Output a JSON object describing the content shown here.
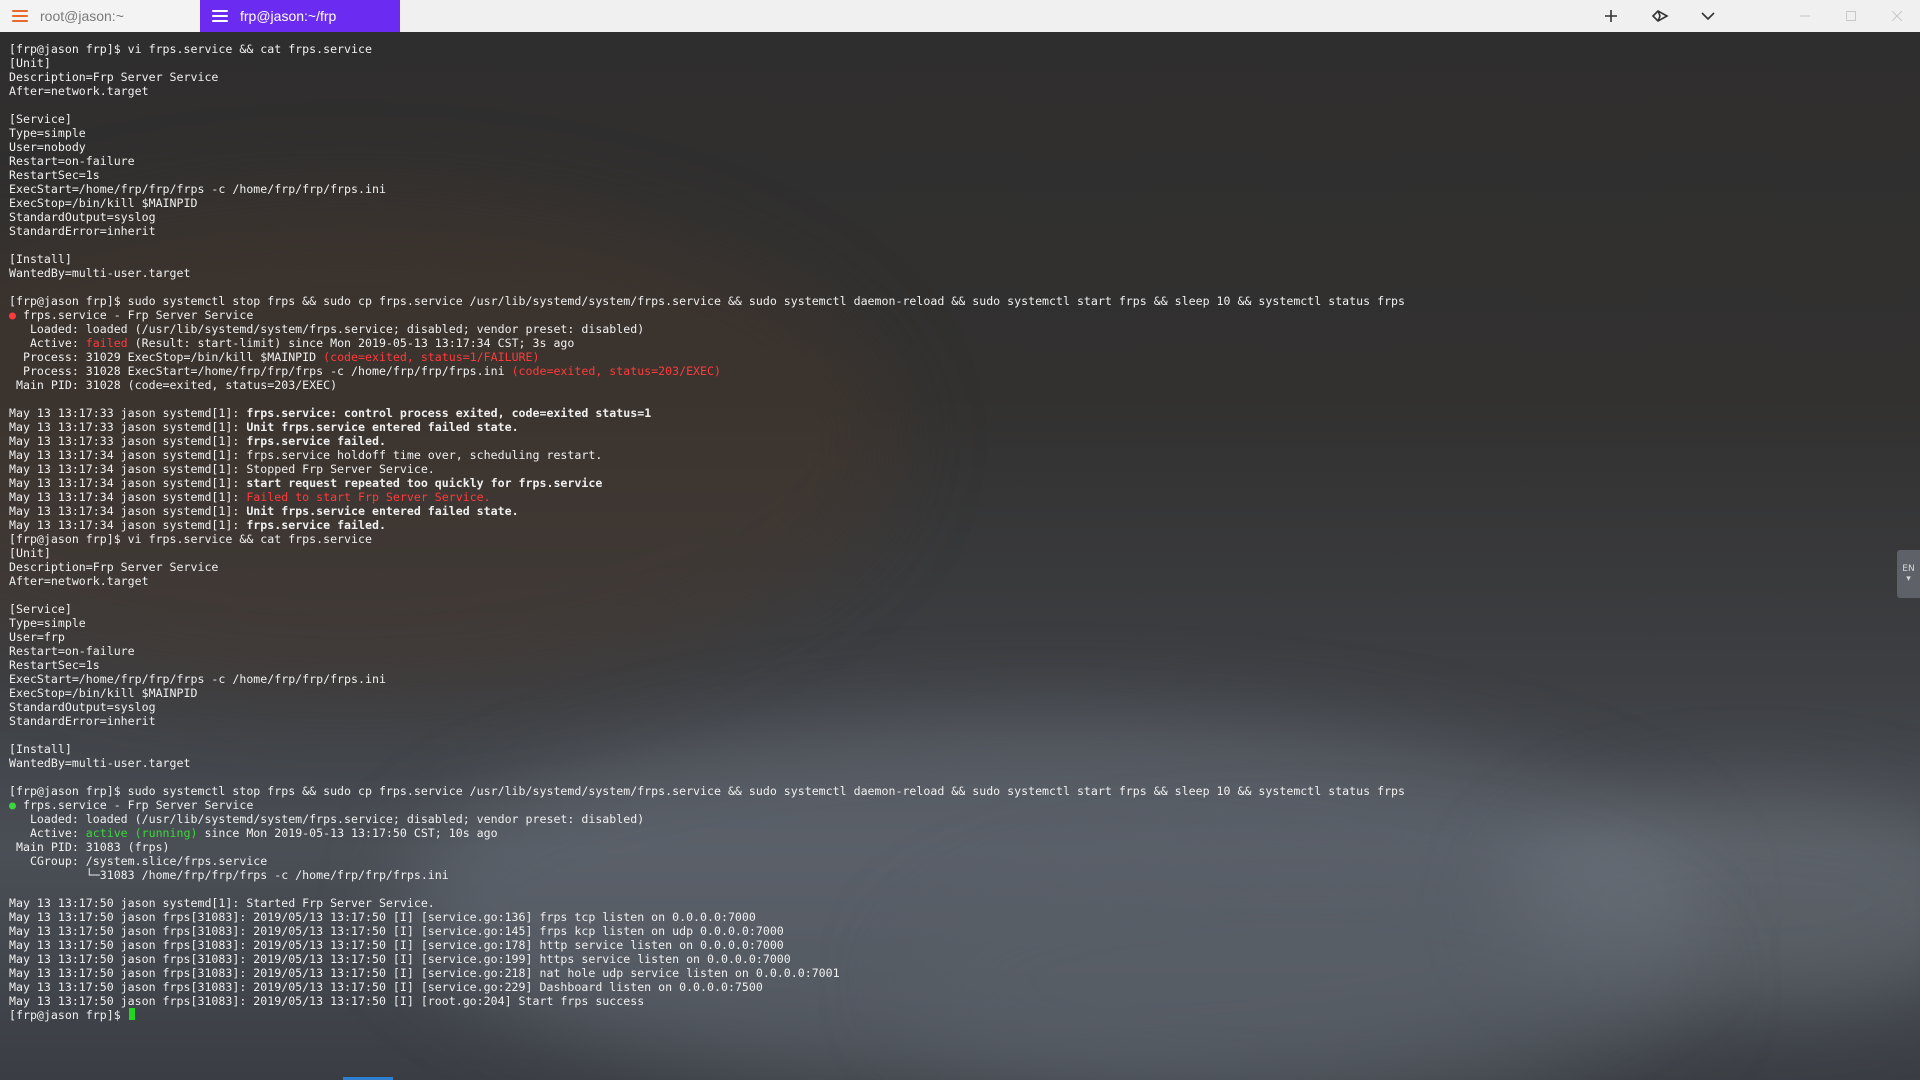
{
  "tabs": [
    {
      "title": "root@jason:~",
      "active": false,
      "icon": "hamburger-menu-icon"
    },
    {
      "title": "frp@jason:~/frp",
      "active": true,
      "icon": "hamburger-menu-icon"
    }
  ],
  "toolbar": {
    "new_tab_icon": "plus-icon",
    "broadcast_icon": "broadcast-icon",
    "dropdown_icon": "chevron-down-icon"
  },
  "colors": {
    "active_tab": "#6b2bf0",
    "error_red": "#ff3b3b",
    "ok_green": "#3bd63b",
    "cursor": "#22d622"
  },
  "ime": {
    "label": "EN"
  },
  "terminal": {
    "lines": [
      [
        {
          "t": "[frp@jason frp]$ vi frps.service && cat frps.service"
        }
      ],
      [
        {
          "t": "[Unit]"
        }
      ],
      [
        {
          "t": "Description=Frp Server Service"
        }
      ],
      [
        {
          "t": "After=network.target"
        }
      ],
      [
        {
          "t": ""
        }
      ],
      [
        {
          "t": "[Service]"
        }
      ],
      [
        {
          "t": "Type=simple"
        }
      ],
      [
        {
          "t": "User=nobody"
        }
      ],
      [
        {
          "t": "Restart=on-failure"
        }
      ],
      [
        {
          "t": "RestartSec=1s"
        }
      ],
      [
        {
          "t": "ExecStart=/home/frp/frp/frps -c /home/frp/frp/frps.ini"
        }
      ],
      [
        {
          "t": "ExecStop=/bin/kill $MAINPID"
        }
      ],
      [
        {
          "t": "StandardOutput=syslog"
        }
      ],
      [
        {
          "t": "StandardError=inherit"
        }
      ],
      [
        {
          "t": ""
        }
      ],
      [
        {
          "t": "[Install]"
        }
      ],
      [
        {
          "t": "WantedBy=multi-user.target"
        }
      ],
      [
        {
          "t": ""
        }
      ],
      [
        {
          "t": "[frp@jason frp]$ sudo systemctl stop frps && sudo cp frps.service /usr/lib/systemd/system/frps.service && sudo systemctl daemon-reload && sudo systemctl start frps && sleep 10 && systemctl status frps"
        }
      ],
      [
        {
          "t": "●",
          "c": "red"
        },
        {
          "t": " frps.service - Frp Server Service"
        }
      ],
      [
        {
          "t": "   Loaded: loaded (/usr/lib/systemd/system/frps.service; disabled; vendor preset: disabled)"
        }
      ],
      [
        {
          "t": "   Active: "
        },
        {
          "t": "failed",
          "c": "red"
        },
        {
          "t": " (Result: start-limit) since Mon 2019-05-13 13:17:34 CST; 3s ago"
        }
      ],
      [
        {
          "t": "  Process: 31029 ExecStop=/bin/kill $MAINPID "
        },
        {
          "t": "(code=exited, status=1/FAILURE)",
          "c": "red"
        }
      ],
      [
        {
          "t": "  Process: 31028 ExecStart=/home/frp/frp/frps -c /home/frp/frp/frps.ini "
        },
        {
          "t": "(code=exited, status=203/EXEC)",
          "c": "red"
        }
      ],
      [
        {
          "t": " Main PID: 31028 (code=exited, status=203/EXEC)"
        }
      ],
      [
        {
          "t": ""
        }
      ],
      [
        {
          "t": "May 13 13:17:33 jason systemd[1]: "
        },
        {
          "t": "frps.service: control process exited, code=exited status=1",
          "c": "bold"
        }
      ],
      [
        {
          "t": "May 13 13:17:33 jason systemd[1]: "
        },
        {
          "t": "Unit frps.service entered failed state.",
          "c": "bold"
        }
      ],
      [
        {
          "t": "May 13 13:17:33 jason systemd[1]: "
        },
        {
          "t": "frps.service failed.",
          "c": "bold"
        }
      ],
      [
        {
          "t": "May 13 13:17:34 jason systemd[1]: frps.service holdoff time over, scheduling restart."
        }
      ],
      [
        {
          "t": "May 13 13:17:34 jason systemd[1]: Stopped Frp Server Service."
        }
      ],
      [
        {
          "t": "May 13 13:17:34 jason systemd[1]: "
        },
        {
          "t": "start request repeated too quickly for frps.service",
          "c": "bold"
        }
      ],
      [
        {
          "t": "May 13 13:17:34 jason systemd[1]: "
        },
        {
          "t": "Failed to start Frp Server Service.",
          "c": "red"
        }
      ],
      [
        {
          "t": "May 13 13:17:34 jason systemd[1]: "
        },
        {
          "t": "Unit frps.service entered failed state.",
          "c": "bold"
        }
      ],
      [
        {
          "t": "May 13 13:17:34 jason systemd[1]: "
        },
        {
          "t": "frps.service failed.",
          "c": "bold"
        }
      ],
      [
        {
          "t": "[frp@jason frp]$ vi frps.service && cat frps.service"
        }
      ],
      [
        {
          "t": "[Unit]"
        }
      ],
      [
        {
          "t": "Description=Frp Server Service"
        }
      ],
      [
        {
          "t": "After=network.target"
        }
      ],
      [
        {
          "t": ""
        }
      ],
      [
        {
          "t": "[Service]"
        }
      ],
      [
        {
          "t": "Type=simple"
        }
      ],
      [
        {
          "t": "User=frp"
        }
      ],
      [
        {
          "t": "Restart=on-failure"
        }
      ],
      [
        {
          "t": "RestartSec=1s"
        }
      ],
      [
        {
          "t": "ExecStart=/home/frp/frp/frps -c /home/frp/frp/frps.ini"
        }
      ],
      [
        {
          "t": "ExecStop=/bin/kill $MAINPID"
        }
      ],
      [
        {
          "t": "StandardOutput=syslog"
        }
      ],
      [
        {
          "t": "StandardError=inherit"
        }
      ],
      [
        {
          "t": ""
        }
      ],
      [
        {
          "t": "[Install]"
        }
      ],
      [
        {
          "t": "WantedBy=multi-user.target"
        }
      ],
      [
        {
          "t": ""
        }
      ],
      [
        {
          "t": "[frp@jason frp]$ sudo systemctl stop frps && sudo cp frps.service /usr/lib/systemd/system/frps.service && sudo systemctl daemon-reload && sudo systemctl start frps && sleep 10 && systemctl status frps"
        }
      ],
      [
        {
          "t": "●",
          "c": "green"
        },
        {
          "t": " frps.service - Frp Server Service"
        }
      ],
      [
        {
          "t": "   Loaded: loaded (/usr/lib/systemd/system/frps.service; disabled; vendor preset: disabled)"
        }
      ],
      [
        {
          "t": "   Active: "
        },
        {
          "t": "active (running)",
          "c": "green"
        },
        {
          "t": " since Mon 2019-05-13 13:17:50 CST; 10s ago"
        }
      ],
      [
        {
          "t": " Main PID: 31083 (frps)"
        }
      ],
      [
        {
          "t": "   CGroup: /system.slice/frps.service"
        }
      ],
      [
        {
          "t": "           └─31083 /home/frp/frp/frps -c /home/frp/frp/frps.ini"
        }
      ],
      [
        {
          "t": ""
        }
      ],
      [
        {
          "t": "May 13 13:17:50 jason systemd[1]: Started Frp Server Service."
        }
      ],
      [
        {
          "t": "May 13 13:17:50 jason frps[31083]: 2019/05/13 13:17:50 [I] [service.go:136] frps tcp listen on 0.0.0.0:7000"
        }
      ],
      [
        {
          "t": "May 13 13:17:50 jason frps[31083]: 2019/05/13 13:17:50 [I] [service.go:145] frps kcp listen on udp 0.0.0.0:7000"
        }
      ],
      [
        {
          "t": "May 13 13:17:50 jason frps[31083]: 2019/05/13 13:17:50 [I] [service.go:178] http service listen on 0.0.0.0:7000"
        }
      ],
      [
        {
          "t": "May 13 13:17:50 jason frps[31083]: 2019/05/13 13:17:50 [I] [service.go:199] https service listen on 0.0.0.0:7000"
        }
      ],
      [
        {
          "t": "May 13 13:17:50 jason frps[31083]: 2019/05/13 13:17:50 [I] [service.go:218] nat hole udp service listen on 0.0.0.0:7001"
        }
      ],
      [
        {
          "t": "May 13 13:17:50 jason frps[31083]: 2019/05/13 13:17:50 [I] [service.go:229] Dashboard listen on 0.0.0.0:7500"
        }
      ],
      [
        {
          "t": "May 13 13:17:50 jason frps[31083]: 2019/05/13 13:17:50 [I] [root.go:204] Start frps success"
        }
      ],
      [
        {
          "t": "[frp@jason frp]$ "
        },
        {
          "t": "",
          "c": "cursor"
        }
      ]
    ]
  }
}
